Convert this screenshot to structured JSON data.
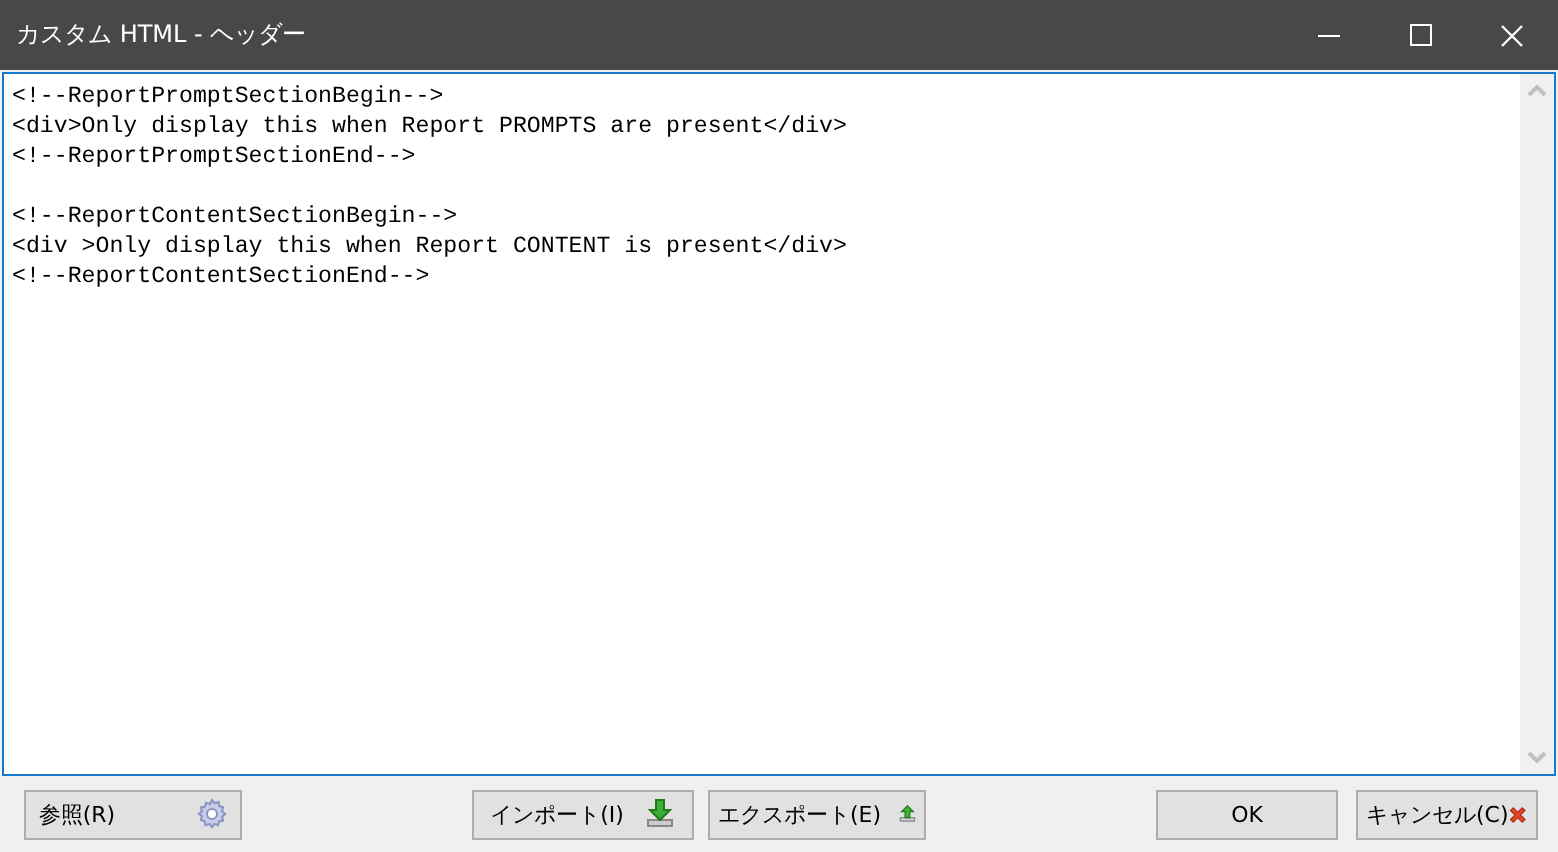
{
  "window": {
    "title": "カスタム HTML - ヘッダー"
  },
  "editor": {
    "blocks": [
      [
        "<!--ReportPromptSectionBegin-->",
        "<div>Only display this when Report PROMPTS are present</div>",
        "<!--ReportPromptSectionEnd-->"
      ],
      [
        "<!--ReportContentSectionBegin-->",
        "<div >Only display this when Report CONTENT is present</div>",
        "<!--ReportContentSectionEnd-->"
      ]
    ]
  },
  "button_bar": {
    "left": [
      {
        "label": "参照(R)",
        "kind": "gear"
      }
    ],
    "middle": [
      {
        "label": "インポート(I)",
        "kind": "import"
      },
      {
        "label": "エクスポート(E)",
        "kind": "export"
      }
    ],
    "right": [
      {
        "label": "OK",
        "kind": "plain"
      },
      {
        "label": "キャンセル(C)",
        "kind": "cancel"
      }
    ]
  }
}
